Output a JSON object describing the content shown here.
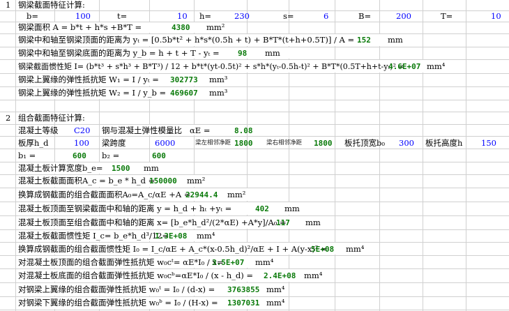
{
  "s1": {
    "num": "1",
    "title": "钢梁截面特征计算:",
    "b_lbl": "b=",
    "b_val": "100",
    "t_lbl": "t=",
    "t_val": "10",
    "h_lbl": "h=",
    "h_val": "230",
    "s_lbl": "s=",
    "s_val": "6",
    "B_lbl": "B=",
    "B_val": "200",
    "T_lbl": "T=",
    "T_val": "10",
    "area_txt": "钢梁面积 A = b*t + h*s +B*T =",
    "area_val": "4380",
    "area_unit": "mm²",
    "yt_txt": "钢梁中和轴至钢梁顶面的距离为 yₜ = [0.5b*t² + h*s*(0.5h + t) + B*T*(t+h+0.5T)] / A =",
    "yt_val": "152",
    "yt_unit": "mm",
    "yb_txt": "钢梁中和轴至钢梁底面的距离为 y_b = h + t + T - yₜ =",
    "yb_val": "98",
    "yb_unit": "mm",
    "I_txt": "钢梁截面惯性矩 I= (b*t³ + s*h³ + B*T³) / 12 + b*t*(yt-0.5t)² + s*h*(yₜ-0.5h-t)² + B*T*(0.5T+h+t-yₜ)² =",
    "I_val": "4.6E+07",
    "I_unit": "mm⁴",
    "W1_txt": "钢梁上翼缘的弹性抵抗矩 W₁ = I / yₜ =",
    "W1_val": "302773",
    "W1_unit": "mm³",
    "W2_txt": "钢梁上翼缘的弹性抵抗矩 W₂ = I / y_b =",
    "W2_val": "469607",
    "W2_unit": "mm³"
  },
  "s2": {
    "num": "2",
    "title": "组合截面特征计算:",
    "grade_lbl": "混凝土等级",
    "grade_val": "C20",
    "ratio_lbl": "钢与混凝土弹性模量比",
    "ratio_sym": "αE =",
    "ratio_val": "8.08",
    "hd_lbl": "板厚h_d",
    "hd_val": "100",
    "span_lbl": "梁跨度",
    "span_val": "6000",
    "left_clear_lbl": "梁左相邻净距",
    "left_clear_val": "1800",
    "right_clear_lbl": "梁右相邻净距",
    "right_clear_val": "1800",
    "rib_w_lbl": "板托顶宽b₀",
    "rib_w_val": "300",
    "rib_h_lbl": "板托高度h",
    "rib_h_val": "150",
    "b1_lbl": "b₁ =",
    "b1_val": "600",
    "b2_lbl": "b₂ =",
    "b2_val": "600",
    "be_txt": "混凝土板计算宽度b_e=",
    "be_val": "1500",
    "be_unit": "mm",
    "Ac_txt": "混凝土板截面面积A_c = b_e * h_d =",
    "Ac_val": "150000",
    "Ac_unit": "mm²",
    "A0_txt": "换算成钢截面的组合截面面积A₀=A_c/αE +A =",
    "A0_val": "22944.4",
    "A0_unit": "mm²",
    "y_txt": "混凝土板顶面至钢梁截面中和轴的距离 y = h_d + hₜ +yₜ =",
    "y_val": "402",
    "y_unit": "mm",
    "x_txt": "混凝土板顶面至组合截面中和轴的距离 x= [b_e*h_d²/(2*αE) +A*y]/A₀ =",
    "x_val": "117",
    "x_unit": "mm",
    "Ic_txt": "混凝土板截面惯性矩 I_c= b_e*h_d³/12=",
    "Ic_val": "1.3E+08",
    "Ic_unit": "mm⁴",
    "I0_txt": "换算成钢截面的组合截面惯性矩 I₀ = I_c/αE + A_c*(x-0.5h_d)²/αE + I + A(y-x)² =",
    "I0_val": "5E+08",
    "I0_unit": "mm⁴",
    "w0ct_txt": "对混凝土板顶面的组合截面弹性抵抗矩 w₀cᵗ= αE*I₀ / x=",
    "w0ct_val": "3.5E+07",
    "w0ct_unit": "mm⁴",
    "w0cb_txt": "对混凝土板底面的组合截面弹性抵抗矩 w₀cᵇ=αE*I₀ / (x - h_d) =",
    "w0cb_val": "2.4E+08",
    "w0cb_unit": "mm⁴",
    "w0t_txt": "对钢梁上翼缘的组合截面弹性抵抗矩 w₀ᵗ = I₀ / (d-x) =",
    "w0t_val": "3763855",
    "w0t_unit": "mm⁴",
    "w0b_txt": "对钢梁下翼缘的组合截面弹性抵抗矩 w₀ᵇ = I₀ / (H-x) =",
    "w0b_val": "1307031",
    "w0b_unit": "mm⁴"
  }
}
